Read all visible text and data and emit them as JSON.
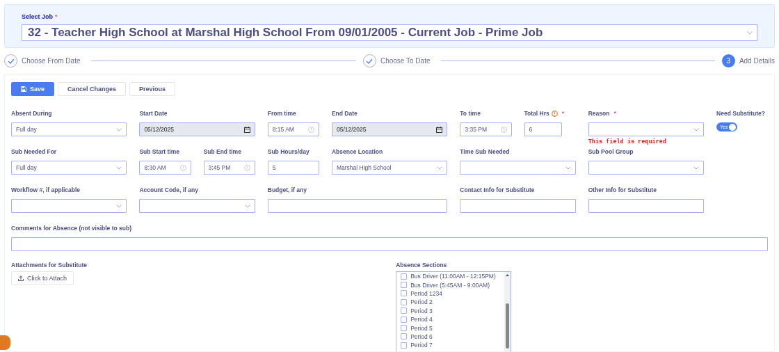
{
  "job": {
    "label": "Select Job",
    "required_mark": "*",
    "value": "32 - Teacher High School at Marshal High School From 09/01/2005 - Current Job - Prime Job"
  },
  "steps": [
    {
      "label": "Choose From Date",
      "completed": true
    },
    {
      "label": "Choose To Date",
      "completed": true
    },
    {
      "label": "Add Details",
      "completed": false,
      "number": "3"
    }
  ],
  "buttons": [
    {
      "label": "Save",
      "kind": "primary"
    },
    {
      "label": "Cancel Changes",
      "kind": "default"
    },
    {
      "label": "Previous",
      "kind": "default"
    }
  ],
  "rows": [
    [
      {
        "kind": "select",
        "label": "Absent During",
        "value": "Full day",
        "disabled": false
      },
      {
        "kind": "date",
        "label": "Start Date",
        "value": "05/12/2025",
        "disabled": true
      },
      {
        "kind": "time",
        "label": "From time",
        "value": "8:15 AM",
        "disabled": false
      },
      {
        "kind": "date",
        "label": "End Date",
        "value": "05/12/2025",
        "disabled": true
      },
      {
        "kind": "time",
        "label": "To time",
        "value": "3:35 PM",
        "disabled": false
      },
      {
        "kind": "short",
        "label": "Total Hrs",
        "value": "6",
        "required_mark": "*",
        "disabled": false,
        "info": true
      },
      {
        "kind": "select",
        "label": "Reason",
        "required_mark": "*",
        "disabled": false,
        "error": "This field is required"
      },
      {
        "kind": "toggle",
        "label": "Need Substitute?",
        "value": "Yes",
        "on": true
      }
    ],
    [
      {
        "kind": "select",
        "label": "Sub Needed For",
        "value": "Full day",
        "disabled": false
      },
      {
        "kind": "time",
        "label": "Sub Start time",
        "value": "8:30 AM",
        "disabled": false
      },
      {
        "kind": "time",
        "label": "Sub End time",
        "value": "3:45 PM",
        "disabled": false
      },
      {
        "kind": "text",
        "label": "Sub Hours/day",
        "value": "5",
        "disabled": false
      },
      {
        "kind": "select",
        "label": "Absence Location",
        "value": "Marshal High School",
        "disabled": false
      },
      {
        "kind": "select",
        "label": "Time Sub Needed",
        "disabled": false
      },
      {
        "kind": "select",
        "label": "Sub Pool Group",
        "disabled": false
      }
    ],
    [
      {
        "kind": "select",
        "label": "Workflow #, if applicable",
        "disabled": false
      },
      {
        "kind": "select",
        "label": "Account Code, if any",
        "disabled": false
      },
      {
        "kind": "text",
        "label": "Budget, if any",
        "disabled": false
      },
      {
        "kind": "text",
        "label": "Contact Info for Substitute",
        "disabled": false
      },
      {
        "kind": "text",
        "label": "Other Info for Substitute",
        "disabled": false
      }
    ],
    [
      {
        "kind": "text",
        "label": "Comments for Absence (not visible to sub)",
        "disabled": false
      }
    ]
  ],
  "attachments": {
    "label": "Attachments for Substitute",
    "button": "Click to Attach"
  },
  "absence_sections": {
    "label": "Absence Sections",
    "items": [
      {
        "label": "Bus Driver (11:00AM - 12:15PM)",
        "checked": false
      },
      {
        "label": "Bus Driver (5:45AM - 9:00AM)",
        "checked": false
      },
      {
        "label": "Period 1234",
        "checked": false
      },
      {
        "label": "Period 2",
        "checked": false
      },
      {
        "label": "Period 3",
        "checked": false
      },
      {
        "label": "Period 4",
        "checked": false
      },
      {
        "label": "Period 5",
        "checked": false
      },
      {
        "label": "Period 6",
        "checked": false
      },
      {
        "label": "Period 7",
        "checked": false
      }
    ]
  }
}
